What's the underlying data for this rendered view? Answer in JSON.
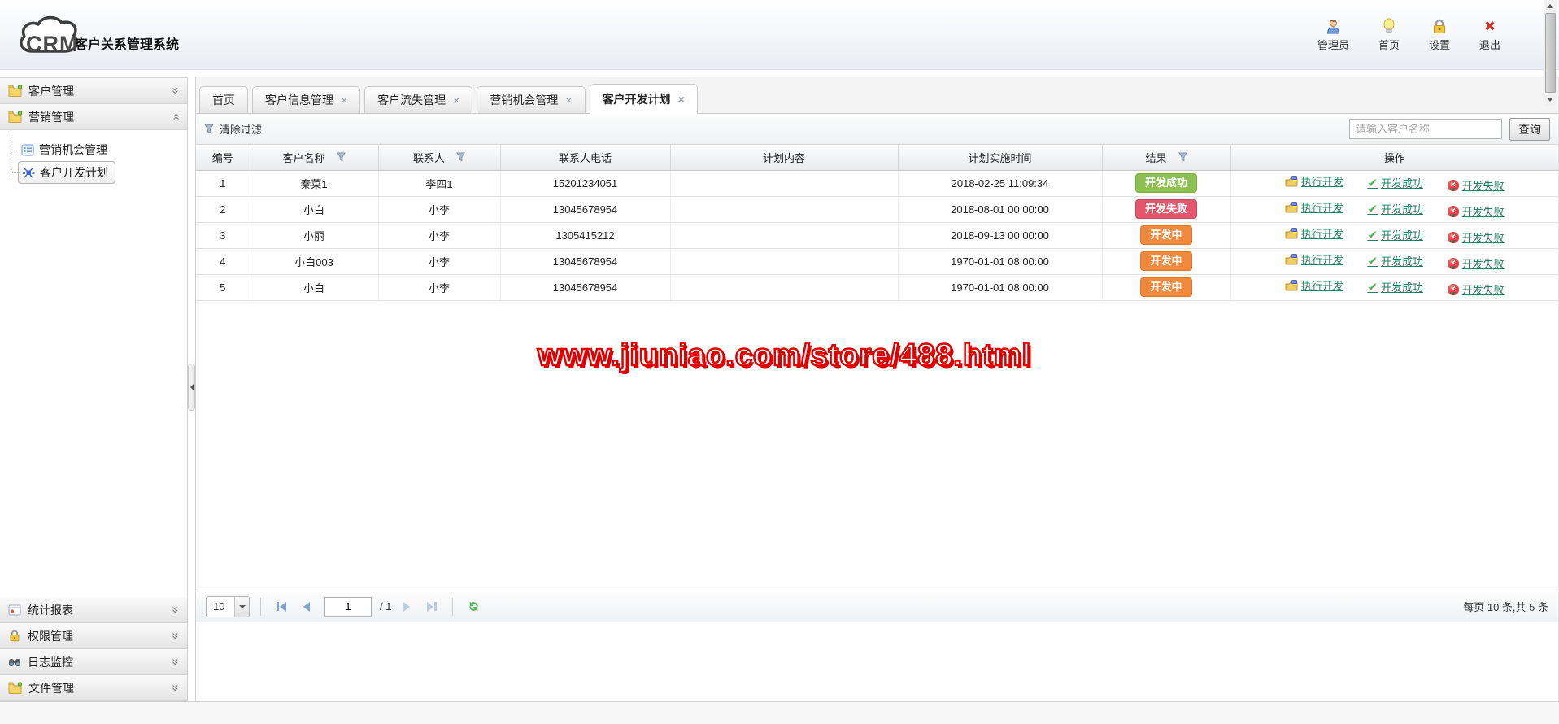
{
  "app": {
    "logo_text": "CRM",
    "title": "客户关系管理系统"
  },
  "header": {
    "actions": [
      {
        "label": "管理员",
        "icon": "user-icon"
      },
      {
        "label": "首页",
        "icon": "lightbulb-icon"
      },
      {
        "label": "设置",
        "icon": "lock-icon"
      },
      {
        "label": "退出",
        "icon": "exit-icon"
      }
    ]
  },
  "sidebar": {
    "groups": [
      {
        "label": "客户管理",
        "icon": "folder-icon",
        "state": "collapsed"
      },
      {
        "label": "营销管理",
        "icon": "folder-icon",
        "state": "expanded",
        "items": [
          {
            "label": "营销机会管理",
            "icon": "list-icon",
            "selected": false
          },
          {
            "label": "客户开发计划",
            "icon": "plan-burst-icon",
            "selected": true
          }
        ]
      },
      {
        "label": "统计报表",
        "icon": "report-icon",
        "state": "collapsed"
      },
      {
        "label": "权限管理",
        "icon": "lock-icon",
        "state": "collapsed"
      },
      {
        "label": "日志监控",
        "icon": "binoculars-icon",
        "state": "collapsed"
      },
      {
        "label": "文件管理",
        "icon": "folder-icon",
        "state": "collapsed"
      }
    ]
  },
  "tabs": [
    {
      "label": "首页",
      "closable": false,
      "active": false
    },
    {
      "label": "客户信息管理",
      "closable": true,
      "active": false
    },
    {
      "label": "客户流失管理",
      "closable": true,
      "active": false
    },
    {
      "label": "营销机会管理",
      "closable": true,
      "active": false
    },
    {
      "label": "客户开发计划",
      "closable": true,
      "active": true
    }
  ],
  "toolbar": {
    "clear_filter_label": "清除过滤",
    "search_placeholder": "请输入客户名称",
    "search_button_label": "查询"
  },
  "table": {
    "columns": [
      {
        "label": "编号",
        "filter": false
      },
      {
        "label": "客户名称",
        "filter": true
      },
      {
        "label": "联系人",
        "filter": true
      },
      {
        "label": "联系人电话",
        "filter": false
      },
      {
        "label": "计划内容",
        "filter": false
      },
      {
        "label": "计划实施时间",
        "filter": false
      },
      {
        "label": "结果",
        "filter": true
      },
      {
        "label": "操作",
        "filter": false
      }
    ],
    "rows": [
      {
        "id": "1",
        "customer": "秦菜1",
        "contact": "李四1",
        "phone": "15201234051",
        "plan_content": "",
        "time": "2018-02-25 11:09:34",
        "result": "开发成功",
        "result_type": "success"
      },
      {
        "id": "2",
        "customer": "小白",
        "contact": "小李",
        "phone": "13045678954",
        "plan_content": "",
        "time": "2018-08-01 00:00:00",
        "result": "开发失败",
        "result_type": "fail"
      },
      {
        "id": "3",
        "customer": "小丽",
        "contact": "小李",
        "phone": "1305415212",
        "plan_content": "",
        "time": "2018-09-13 00:00:00",
        "result": "开发中",
        "result_type": "progress"
      },
      {
        "id": "4",
        "customer": "小白003",
        "contact": "小李",
        "phone": "13045678954",
        "plan_content": "",
        "time": "1970-01-01 08:00:00",
        "result": "开发中",
        "result_type": "progress"
      },
      {
        "id": "5",
        "customer": "小白",
        "contact": "小李",
        "phone": "13045678954",
        "plan_content": "",
        "time": "1970-01-01 08:00:00",
        "result": "开发中",
        "result_type": "progress"
      }
    ],
    "row_actions": [
      {
        "label": "执行开发",
        "icon": "execute-develop-icon"
      },
      {
        "label": "开发成功",
        "icon": "develop-success-icon"
      },
      {
        "label": "开发失败",
        "icon": "develop-fail-icon"
      }
    ]
  },
  "watermark": {
    "text": "www.jiuniao.com/store/488.html",
    "color": "#e00000"
  },
  "pager": {
    "page_size": "10",
    "page_value": "1",
    "total_label": "/ 1",
    "summary": "每页 10 条,共 5 条"
  },
  "colors": {
    "badge_success": "#8cc152",
    "badge_fail": "#e4566b",
    "badge_progress": "#f0883e",
    "action_link": "#1f8060",
    "watermark": "#e00000"
  }
}
